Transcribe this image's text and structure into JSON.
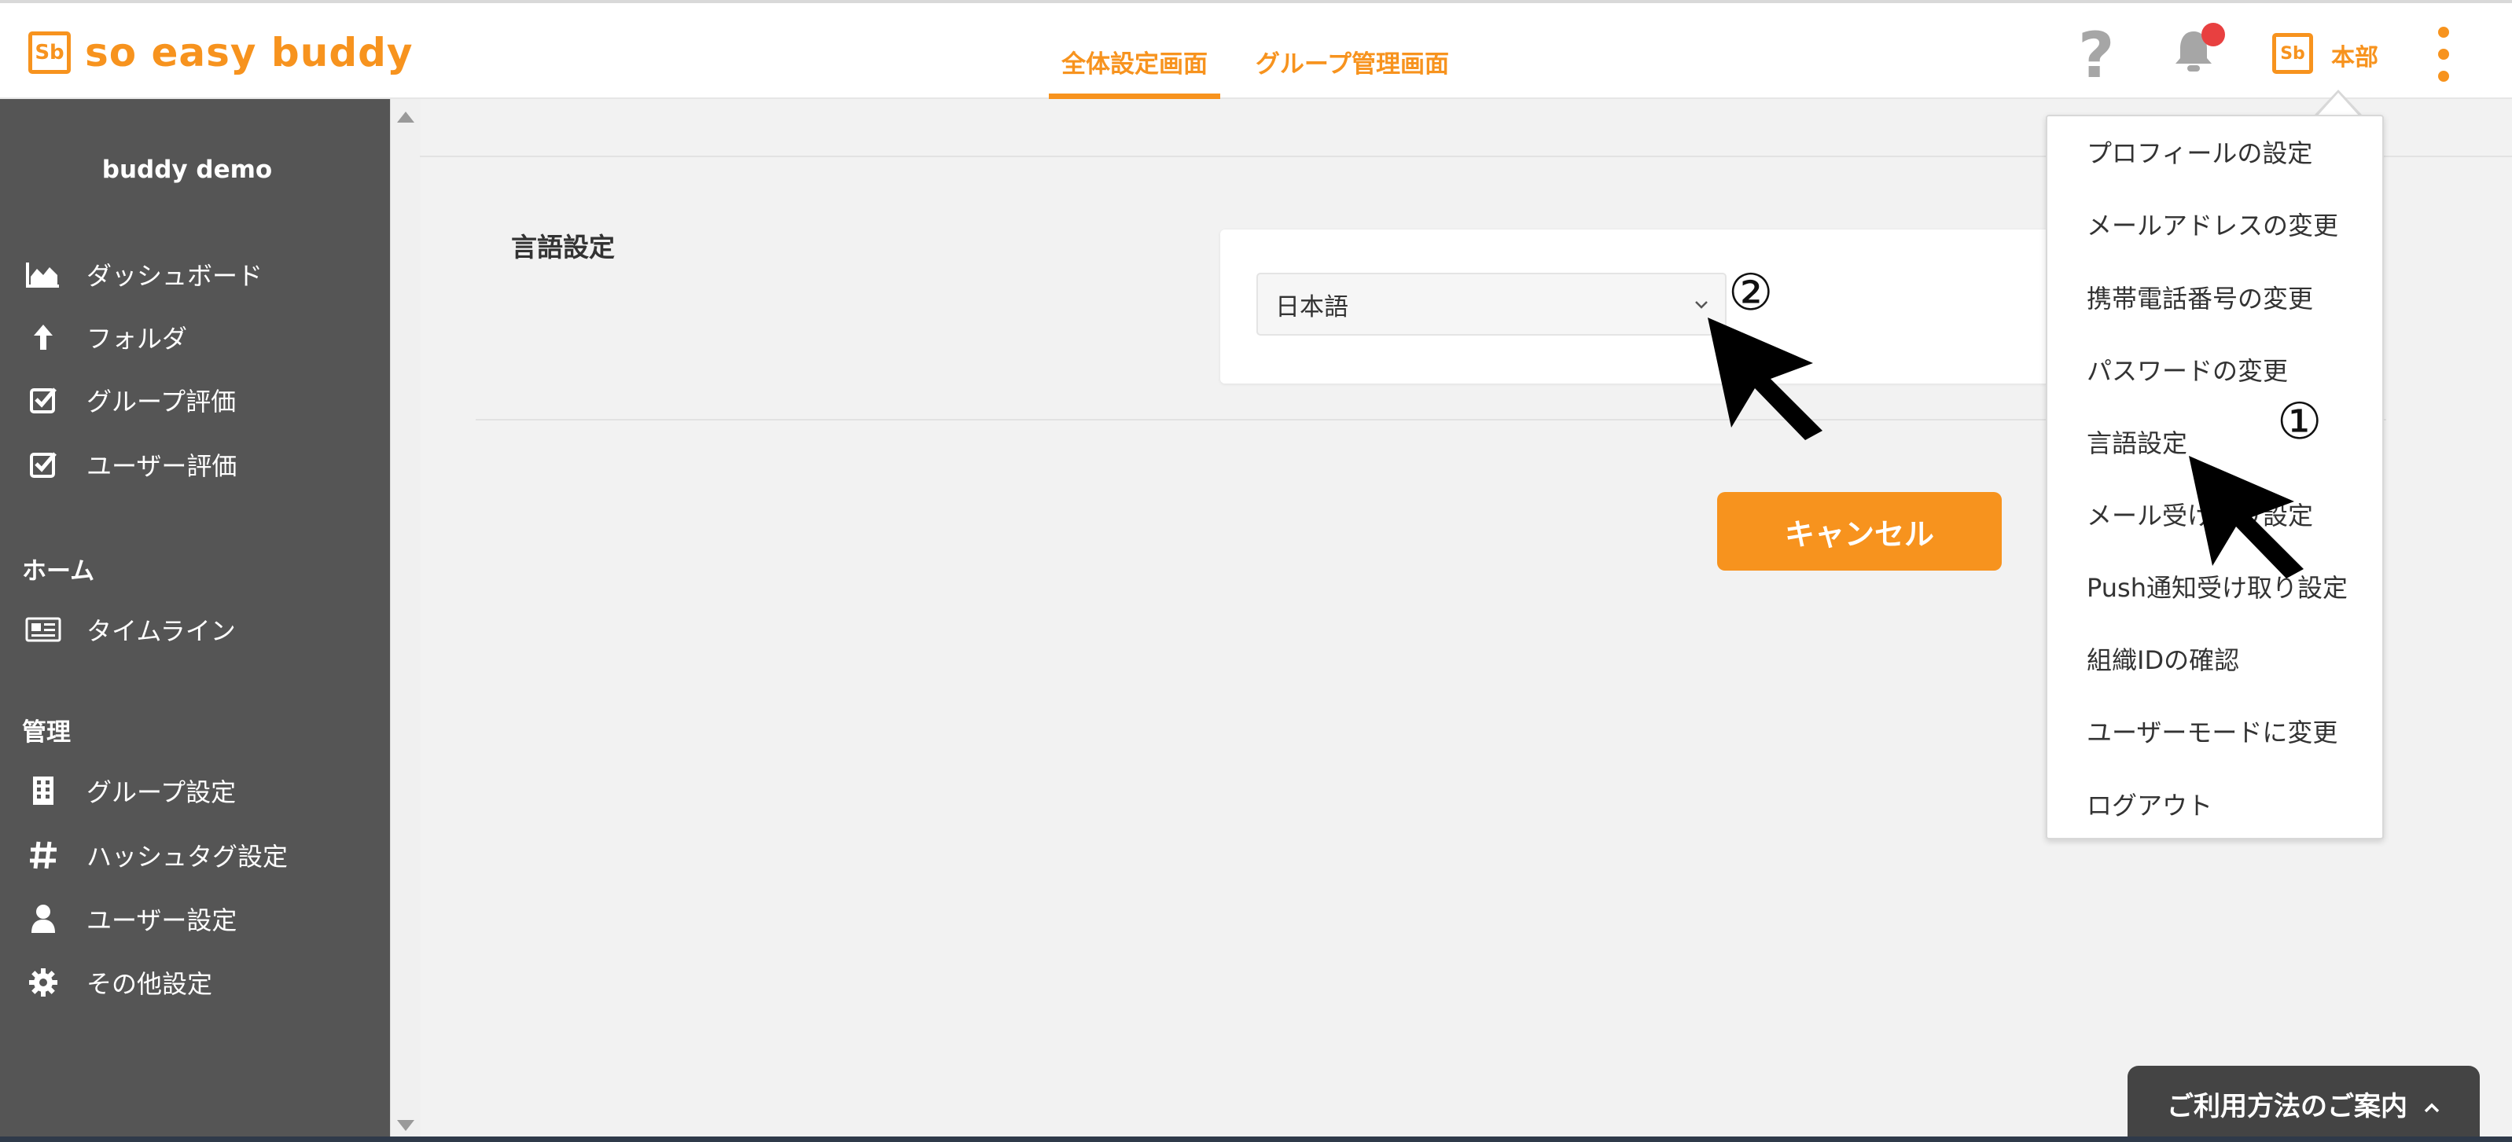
{
  "header": {
    "logo_mark": "Sb",
    "logo_text": "so easy buddy",
    "tabs": [
      {
        "label": "全体設定画面",
        "active": true
      },
      {
        "label": "グループ管理画面",
        "active": false
      }
    ],
    "help_glyph": "?",
    "org_logo_mark": "Sb",
    "org_name": "本部",
    "icons": [
      "help-icon",
      "bell-icon",
      "kebab-menu-icon"
    ],
    "notification_dot_color": "#e84040"
  },
  "sidebar": {
    "org_name": "buddy demo",
    "items": [
      {
        "label": "ダッシュボード",
        "icon": "chart-area-icon"
      },
      {
        "label": "フォルダ",
        "icon": "arrow-up-icon"
      },
      {
        "label": "グループ評価",
        "icon": "check-square-icon"
      },
      {
        "label": "ユーザー評価",
        "icon": "check-square-icon"
      }
    ],
    "section_home": "ホーム",
    "home_items": [
      {
        "label": "タイムライン",
        "icon": "newspaper-icon"
      }
    ],
    "section_admin": "管理",
    "admin_items": [
      {
        "label": "グループ設定",
        "icon": "building-icon"
      },
      {
        "label": "ハッシュタグ設定",
        "icon": "hashtag-icon"
      },
      {
        "label": "ユーザー設定",
        "icon": "user-icon"
      },
      {
        "label": "その他設定",
        "icon": "gear-icon"
      }
    ]
  },
  "main": {
    "section_label": "言語設定",
    "language_select_value": "日本語",
    "cancel_label": "キャンセル"
  },
  "dropdown": {
    "items": [
      "プロフィールの設定",
      "メールアドレスの変更",
      "携帯電話番号の変更",
      "パスワードの変更",
      "言語設定",
      "メール受け取り設定",
      "Push通知受け取り設定",
      "組織IDの確認",
      "ユーザーモードに変更",
      "ログアウト"
    ]
  },
  "annotations": {
    "marker_1": "①",
    "marker_2": "②"
  },
  "help_tab": {
    "label": "ご利用方法のご案内"
  },
  "colors": {
    "accent": "#f7931e",
    "sidebar_bg": "#555555",
    "help_tab_bg": "#444444"
  }
}
